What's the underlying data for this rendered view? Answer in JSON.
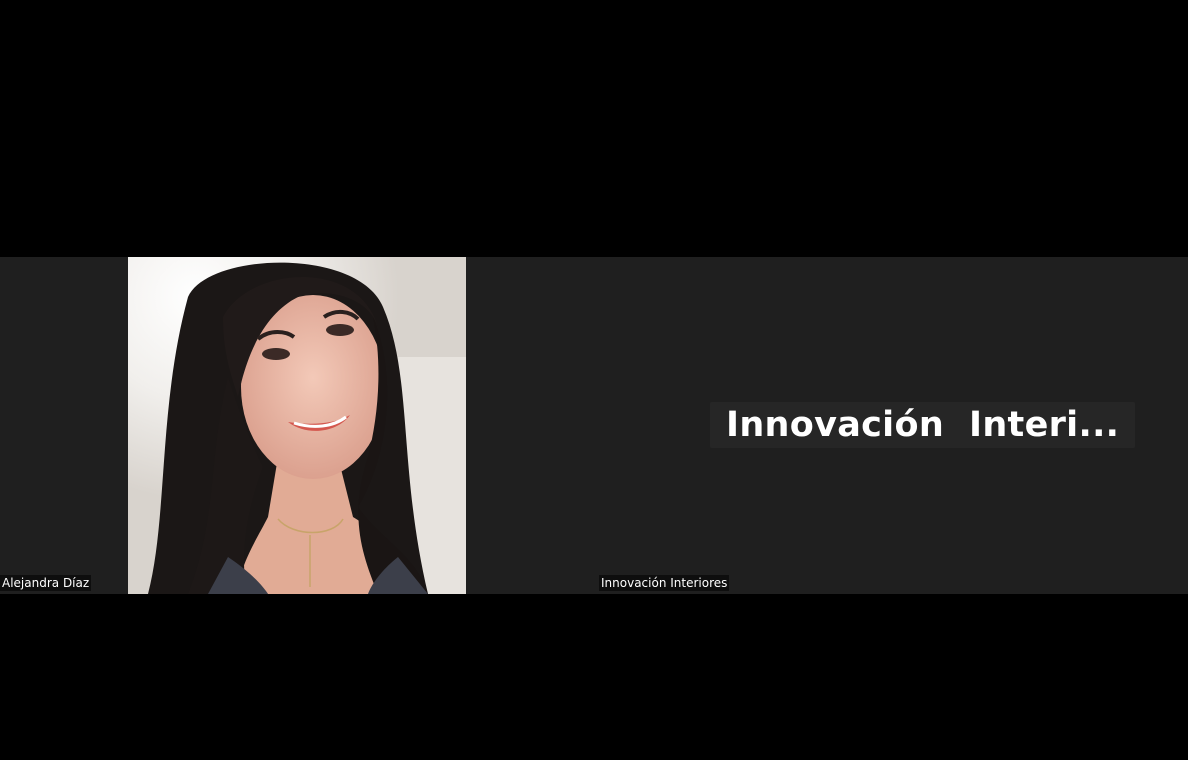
{
  "participants": [
    {
      "display_name": "Alejandra Díaz",
      "video": "camera-on"
    },
    {
      "display_name": "Innovación Interiores",
      "avatar_text": "Innovación  Interi...",
      "video": "camera-off"
    }
  ],
  "colors": {
    "page_bg": "#000000",
    "tile_bg": "#1f1f1f",
    "label_text": "#ffffff"
  }
}
